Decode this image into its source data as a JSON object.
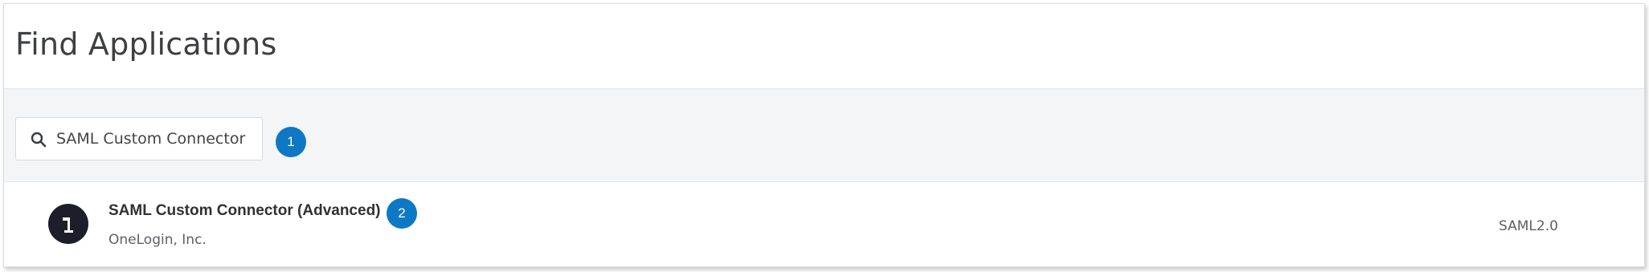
{
  "header": {
    "title": "Find Applications"
  },
  "search": {
    "value": "SAML Custom Connector",
    "icon": "search-icon"
  },
  "callouts": {
    "first": "1",
    "second": "2"
  },
  "results": [
    {
      "name": "SAML Custom Connector (Advanced)",
      "vendor": "OneLogin, Inc.",
      "protocol": "SAML2.0",
      "logo": "onelogin-logo"
    }
  ],
  "colors": {
    "callout": "#0f78c4",
    "logo_background": "#1c1f2a",
    "search_band": "#f4f5f7"
  }
}
